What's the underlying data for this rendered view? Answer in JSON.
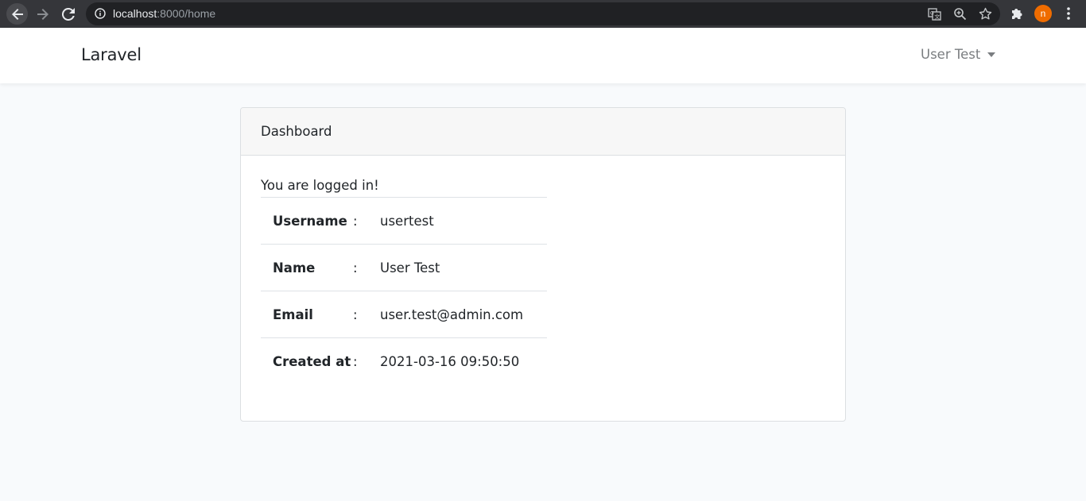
{
  "browser": {
    "url_host": "localhost",
    "url_rest": ":8000/home",
    "profile_initial": "n",
    "icons": [
      "back-arrow-icon",
      "forward-arrow-icon",
      "reload-icon",
      "info-icon",
      "translate-icon",
      "zoom-icon",
      "star-icon",
      "puzzle-icon",
      "kebab-menu-icon"
    ]
  },
  "navbar": {
    "brand": "Laravel",
    "user_name": "User Test"
  },
  "card": {
    "header": "Dashboard",
    "status": "You are logged in!",
    "rows": [
      {
        "label": "Username",
        "sep": ":",
        "value": "usertest"
      },
      {
        "label": "Name",
        "sep": ":",
        "value": "User Test"
      },
      {
        "label": "Email",
        "sep": ":",
        "value": "user.test@admin.com"
      },
      {
        "label": "Created at",
        "sep": ":",
        "value": "2021-03-16 09:50:50"
      }
    ]
  },
  "colors": {
    "page_bg": "#f8fafc",
    "chrome_bg": "#35363a",
    "omnibox_bg": "#202124",
    "avatar": "#ef6c00"
  }
}
